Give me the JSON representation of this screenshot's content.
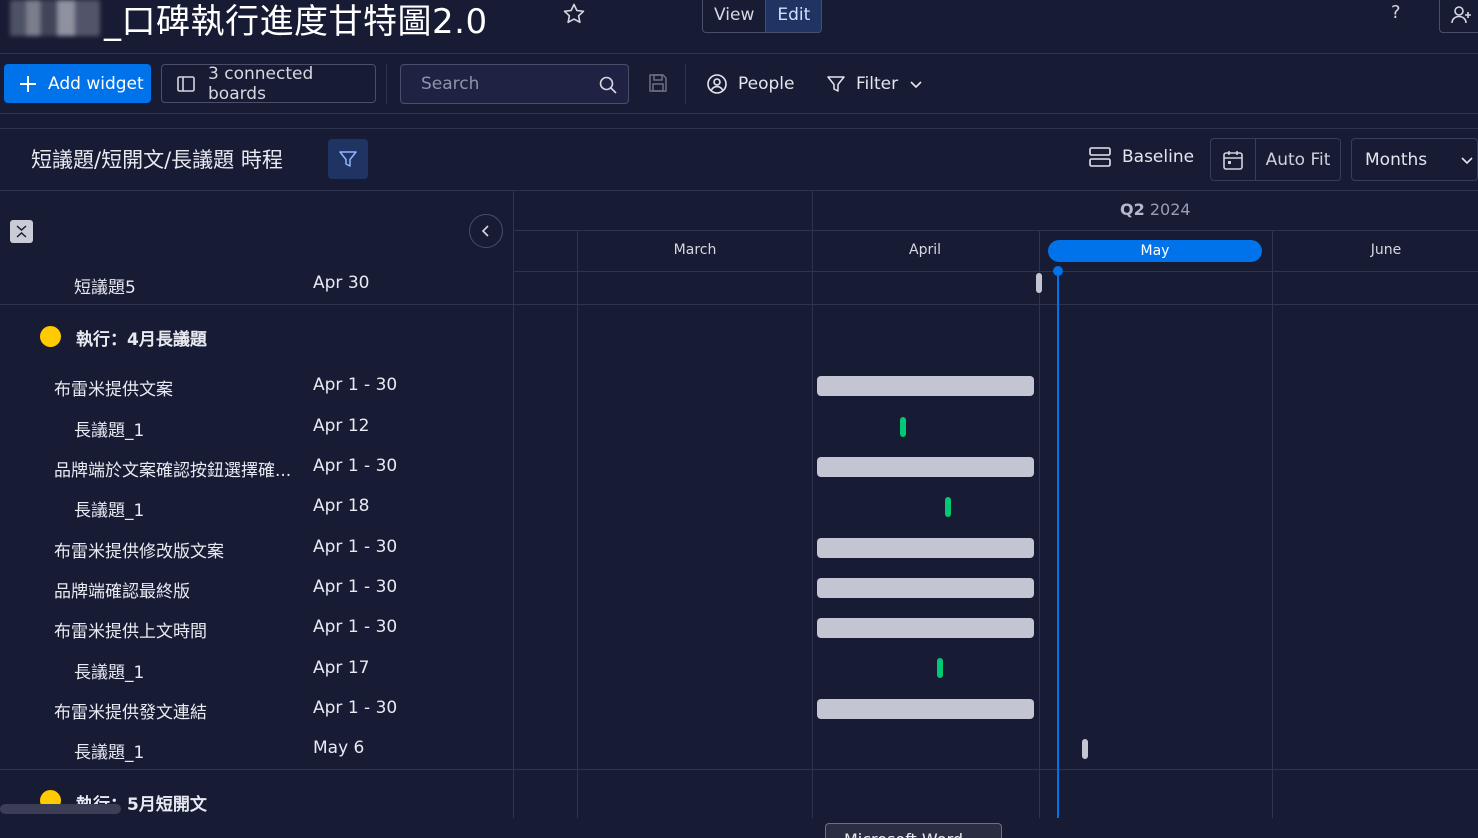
{
  "header": {
    "board_title": "_口碑執行進度甘特圖2.0",
    "view_label": "View",
    "edit_label": "Edit",
    "help_label": "?"
  },
  "toolbar": {
    "add_widget_label": "Add widget",
    "connected_boards_label": "3 connected boards",
    "search_placeholder": "Search",
    "people_label": "People",
    "filter_label": "Filter"
  },
  "widget": {
    "title": "短議題/短開文/長議題 時程",
    "baseline_label": "Baseline",
    "autofit_label": "Auto Fit",
    "zoom_selected": "Months"
  },
  "timeline": {
    "quarter_prefix": "Q2",
    "quarter_year": "2024",
    "months": [
      "March",
      "April",
      "May",
      "June"
    ],
    "current_month": "May"
  },
  "rows": [
    {
      "name": "短議題5",
      "date": "Apr 30",
      "type": "subitem"
    },
    {
      "name": "執行：4月長議題",
      "type": "group",
      "color": "#ffcb00"
    },
    {
      "name": "布雷米提供文案",
      "date": "Apr 1 - 30",
      "type": "item"
    },
    {
      "name": "長議題_1",
      "date": "Apr 12",
      "type": "subitem"
    },
    {
      "name": "品牌端於文案確認按鈕選擇確...",
      "date": "Apr 1 - 30",
      "type": "item"
    },
    {
      "name": "長議題_1",
      "date": "Apr 18",
      "type": "subitem"
    },
    {
      "name": "布雷米提供修改版文案",
      "date": "Apr 1 - 30",
      "type": "item"
    },
    {
      "name": "品牌端確認最終版",
      "date": "Apr 1 - 30",
      "type": "item"
    },
    {
      "name": "布雷米提供上文時間",
      "date": "Apr 1 - 30",
      "type": "item"
    },
    {
      "name": "長議題_1",
      "date": "Apr 17",
      "type": "subitem"
    },
    {
      "name": "布雷米提供發文連結",
      "date": "Apr 1 - 30",
      "type": "item"
    },
    {
      "name": "長議題_1",
      "date": "May 6",
      "type": "subitem"
    },
    {
      "name": "執行：5月短開文",
      "type": "group",
      "color": "#ffcb00"
    }
  ],
  "tooltip": {
    "text": "Microsoft Word"
  },
  "colors": {
    "accent": "#0073ea",
    "group_dot": "#ffcb00",
    "milestone_green": "#00c875",
    "bar_grey": "#c3c6d2",
    "background": "#181b34"
  },
  "icons": [
    "star-icon",
    "help-icon",
    "invite-icon",
    "plus-icon",
    "board-icon",
    "search-icon",
    "save-icon",
    "person-icon",
    "filter-icon",
    "chevron-down-icon",
    "baseline-icon",
    "calendar-icon",
    "collapse-all-icon",
    "chevron-left-icon"
  ]
}
